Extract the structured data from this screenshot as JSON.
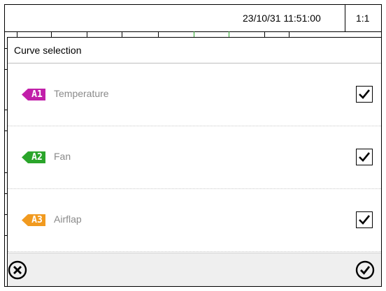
{
  "statusbar": {
    "datetime": "23/10/31 11:51:00",
    "page": "1:1"
  },
  "dialog": {
    "title": "Curve selection",
    "curves": [
      {
        "tag": "A1",
        "label": "Temperature",
        "color": "#c11fa9",
        "checked": true
      },
      {
        "tag": "A2",
        "label": "Fan",
        "color": "#2aa52a",
        "checked": true
      },
      {
        "tag": "A3",
        "label": "Airflap",
        "color": "#f19a1f",
        "checked": true
      }
    ],
    "footer": {
      "cancel_icon": "close-circle-icon",
      "confirm_icon": "check-circle-icon"
    }
  }
}
